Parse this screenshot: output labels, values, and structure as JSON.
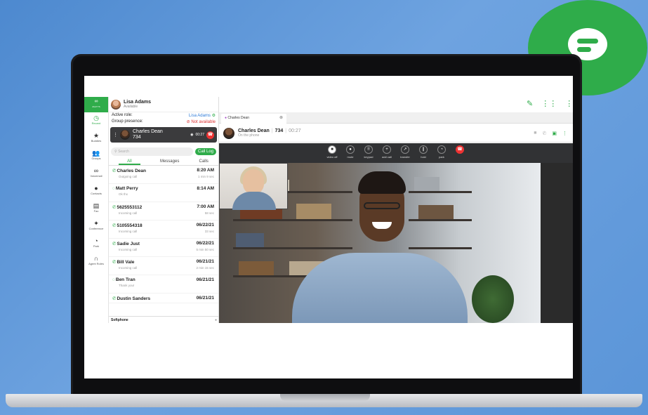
{
  "user": {
    "name": "Lisa Adams",
    "status": "Available"
  },
  "roles": {
    "active_role_label": "Active role:",
    "active_role_value": "Lisa Adams",
    "group_presence_label": "Group presence:",
    "group_presence_value": "Not available"
  },
  "nav": {
    "logo": "ZULTYS",
    "items": [
      {
        "label": "Recent",
        "icon": "clock-icon"
      },
      {
        "label": "Buddies",
        "icon": "star-icon"
      },
      {
        "label": "Groups",
        "icon": "group-icon"
      },
      {
        "label": "Voicemail",
        "icon": "voicemail-icon"
      },
      {
        "label": "Contacts",
        "icon": "contact-icon"
      },
      {
        "label": "Fax",
        "icon": "fax-icon"
      },
      {
        "label": "Conference",
        "icon": "conference-icon"
      },
      {
        "label": "Park",
        "icon": "park-icon"
      },
      {
        "label": "Agent Roles",
        "icon": "headset-icon"
      }
    ]
  },
  "active_call": {
    "name": "Charles Dean",
    "ext": "734",
    "timer": "00:27"
  },
  "search": {
    "placeholder": "Search",
    "call_log_label": "Call Log"
  },
  "tabs": [
    "All",
    "Messages",
    "Calls"
  ],
  "call_log": [
    {
      "name": "Charles Dean",
      "time": "8:20 AM",
      "sub": "Outgoing call",
      "dur": "1 min 9 sec",
      "icon": "phone-out-icon"
    },
    {
      "name": "Matt Perry",
      "time": "8:14 AM",
      "sub": "Ok thx",
      "dur": "",
      "icon": "chat-icon"
    },
    {
      "name": "5625553112",
      "time": "7:00 AM",
      "sub": "Incoming call",
      "dur": "58 sec",
      "icon": "phone-in-icon"
    },
    {
      "name": "5105554318",
      "time": "06/22/21",
      "sub": "Incoming call",
      "dur": "33 sec",
      "icon": "phone-in-icon"
    },
    {
      "name": "Sadie Just",
      "time": "06/22/21",
      "sub": "Incoming call",
      "dur": "5 min 50 sec",
      "icon": "phone-in-icon"
    },
    {
      "name": "Bill Vale",
      "time": "06/21/21",
      "sub": "Incoming call",
      "dur": "2 min 15 sec",
      "icon": "phone-in-icon"
    },
    {
      "name": "Ben Tran",
      "time": "06/21/21",
      "sub": "Thank you!",
      "dur": "",
      "icon": "chat-icon"
    },
    {
      "name": "Dustin Sanders",
      "time": "06/21/21",
      "sub": "",
      "dur": "",
      "icon": "phone-in-icon"
    }
  ],
  "softphone_label": "Softphone",
  "call_tab": {
    "label": "Charles Dean"
  },
  "call_header": {
    "name": "Charles Dean",
    "ext": "734",
    "time": "00:27",
    "status": "On the phone"
  },
  "controls": [
    {
      "label": "video off",
      "icon": "video-icon"
    },
    {
      "label": "mute",
      "icon": "mic-icon"
    },
    {
      "label": "keypad",
      "icon": "keypad-icon"
    },
    {
      "label": "add call",
      "icon": "plus-icon"
    },
    {
      "label": "transfer",
      "icon": "transfer-icon"
    },
    {
      "label": "hold",
      "icon": "pause-icon"
    },
    {
      "label": "park",
      "icon": "park-icon"
    },
    {
      "label": "",
      "icon": "hangup-icon"
    }
  ],
  "colors": {
    "accent": "#2fac4a",
    "danger": "#e33333",
    "background": "#5b95d8"
  }
}
